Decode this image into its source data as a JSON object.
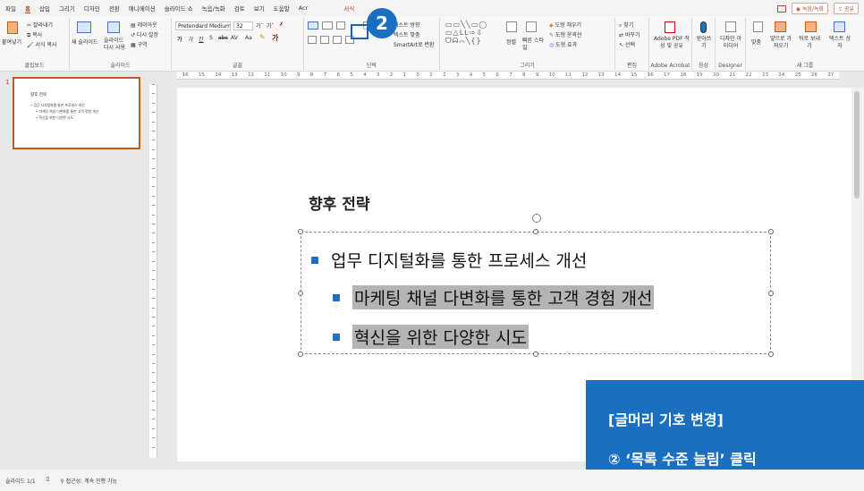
{
  "menu": {
    "items": [
      "파일",
      "홈",
      "삽입",
      "그리기",
      "디자인",
      "전환",
      "애니메이션",
      "슬라이드 쇼",
      "녹음/녹화",
      "검토",
      "보기",
      "도움말",
      "Acr",
      "서식"
    ],
    "active_index": 1,
    "record_label": "◉ 녹음/녹화",
    "share_label": "공유"
  },
  "ribbon": {
    "clipboard": {
      "paste": "붙여넣기",
      "cut": "잘라내기",
      "copy": "복사",
      "format_painter": "서식 복사",
      "label": "클립보드"
    },
    "slides": {
      "new_slide": "새 슬라이드",
      "reuse": "슬라이드 다시 사용",
      "layout": "레이아웃",
      "reset": "다시 설정",
      "section": "구역",
      "label": "슬라이드"
    },
    "font": {
      "font_name": "Pretendard Medium",
      "font_size": "32",
      "label": "글꼴"
    },
    "paragraph": {
      "text_direction": "텍스트 방향",
      "align_text": "텍스트 맞춤",
      "smartart": "SmartArt로 변환",
      "label": "단락"
    },
    "drawing": {
      "arrange": "정렬",
      "quick_styles": "빠른 스타일",
      "shape_fill": "도형 채우기",
      "shape_outline": "도형 윤곽선",
      "shape_effects": "도형 효과",
      "label": "그리기"
    },
    "editing": {
      "find": "찾기",
      "replace": "바꾸기",
      "select": "선택",
      "label": "편집"
    },
    "adobe": {
      "create_pdf": "Adobe PDF 작성 및 공유",
      "label": "Adobe Acrobat"
    },
    "voice": {
      "dictate": "받아쓰기",
      "label": "음성"
    },
    "designer": {
      "ideas": "디자인 아이디어",
      "label": "Designer"
    },
    "newgroup": {
      "items": [
        "맞춤",
        "앞으로 가져오기",
        "뒤로 보내기",
        "텍스트 상자"
      ],
      "label": "새 그룹"
    }
  },
  "ruler": {
    "ticks": [
      "16",
      "15",
      "14",
      "13",
      "12",
      "11",
      "10",
      "9",
      "8",
      "7",
      "6",
      "5",
      "4",
      "3",
      "2",
      "1",
      "0",
      "1",
      "2",
      "3",
      "4",
      "5",
      "6",
      "7",
      "8",
      "9",
      "10",
      "11",
      "12",
      "13",
      "14",
      "15",
      "16",
      "17",
      "18",
      "19",
      "20",
      "21",
      "22",
      "23",
      "24",
      "25",
      "26",
      "27"
    ]
  },
  "thumbnail": {
    "number": "1",
    "title": "향후 전략",
    "line1": "• 업무 디지털화를 통한 프로세스 개선",
    "line2": "• 마케팅 채널 다변화를 통한 고객 경험 개선",
    "line3": "• 혁신을 위한 다양한 시도"
  },
  "slide": {
    "title": "향후 전략",
    "bullets": [
      {
        "text": "업무 디지털화를 통한 프로세스 개선",
        "level": 1,
        "selected": false
      },
      {
        "text": "마케팅 채널 다변화를 통한 고객 경험 개선",
        "level": 2,
        "selected": true
      },
      {
        "text": "혁신을 위한 다양한 시도",
        "level": 2,
        "selected": true
      }
    ],
    "bullet_color": "#1f6fc5"
  },
  "step": {
    "number": "2"
  },
  "callout": {
    "line1": "[글머리 기호 변경]",
    "line2": "② ‘목록 수준 늘림’ 클릭",
    "color": "#1a6fc1"
  },
  "status": {
    "slide_count": "슬라이드 1/1",
    "accessibility": "접근성: 계속 진행 가능"
  }
}
